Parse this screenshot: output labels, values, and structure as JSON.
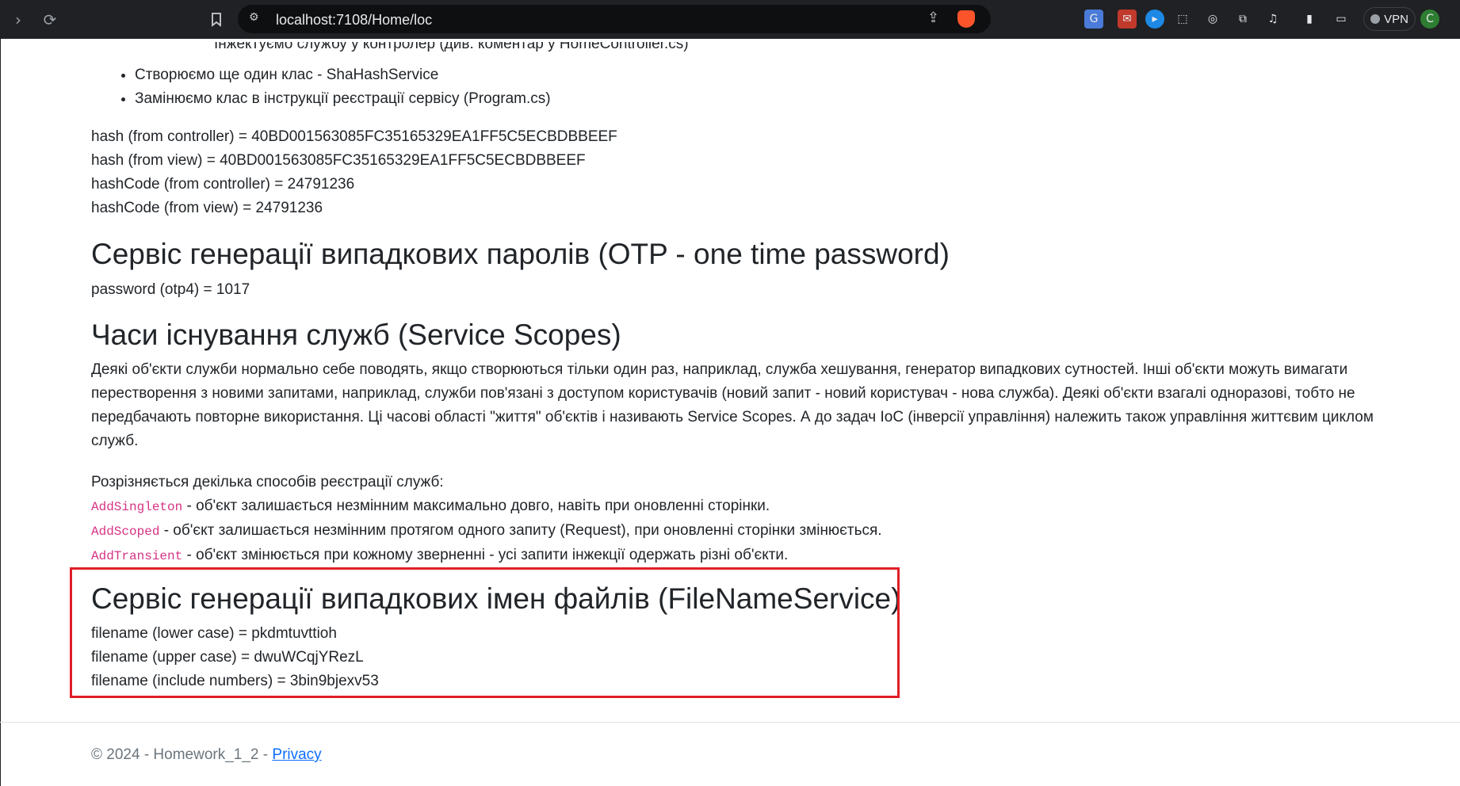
{
  "browser": {
    "url": "localhost:7108/Home/loc",
    "vpn_label": "VPN"
  },
  "content": {
    "cut_off_line": "Інжектуємо службу у контролер (див. коментар у HomeController.cs)",
    "bullets": [
      "Створюємо ще один клас - ShaHashService",
      "Замінюємо клас в інструкції реєстрації сервісу (Program.cs)"
    ],
    "hash_lines": [
      "hash (from controller) = 40BD001563085FC35165329EA1FF5C5ECBDBBEEF",
      "hash (from view) = 40BD001563085FC35165329EA1FF5C5ECBDBBEEF",
      "hashCode (from controller) = 24791236",
      "hashCode (from view) = 24791236"
    ],
    "otp_heading": "Сервіс генерації випадкових паролів (OTP - one time password)",
    "otp_line": "password (otp4) = 1017",
    "scopes_heading": "Часи існування служб (Service Scopes)",
    "scopes_paragraph": "Деякі об'єкти служби нормально себе поводять, якщо створюються тільки один раз, наприклад, служба хешування, генератор випадкових сутностей. Інші об'єкти можуть вимагати перестворення з новими запитами, наприклад, служби пов'язані з доступом користувачів (новий запит - новий користувач - нова служба). Деякі об'єкти взагалі одноразові, тобто не передбачають повторне використання. Ці часові області \"життя\" об'єктів і називають Service Scopes. А до задач IoC (інверсії управління) належить також управління життєвим циклом служб.",
    "registration_intro": "Розрізняється декілька способів реєстрації служб:",
    "registrations": [
      {
        "code": "AddSingleton",
        "text": " - об'єкт залишається незмінним максимально довго, навіть при оновленні сторінки."
      },
      {
        "code": "AddScoped",
        "text": " - об'єкт залишається незмінним протягом одного запиту (Request), при оновленні сторінки змінюється."
      },
      {
        "code": "AddTransient",
        "text": " - об'єкт змінюється при кожному зверненні - усі запити інжекції одержать різні об'єкти."
      }
    ],
    "filename_heading": "Сервіс генерації випадкових імен файлів (FileNameService)",
    "filename_lines": [
      "filename (lower case) = pkdmtuvttioh",
      "filename (upper case) = dwuWCqjYRezL",
      "filename (include numbers) = 3bin9bjexv53"
    ]
  },
  "footer": {
    "text": "© 2024 - Homework_1_2 - ",
    "privacy_link": "Privacy"
  },
  "colors": {
    "highlight_border": "#e01e26",
    "code": "#d63384",
    "link": "#0d6efd"
  }
}
